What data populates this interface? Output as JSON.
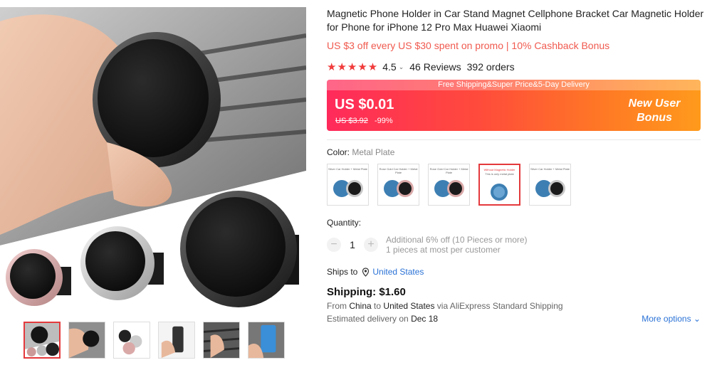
{
  "product": {
    "title": "Magnetic Phone Holder in Car Stand Magnet Cellphone Bracket Car Magnetic Holder for Phone for iPhone 12 Pro Max Huawei Xiaomi",
    "promo": "US $3 off every US $30 spent on promo | 10% Cashback Bonus",
    "rating": {
      "stars": "★★★★★",
      "value": "4.5",
      "reviews": "46 Reviews",
      "orders": "392 orders"
    }
  },
  "price": {
    "banner": "Free Shipping&Super Price&5-Day Delivery",
    "current": "US $0.01",
    "original": "US $3.92",
    "discount": "-99%",
    "new_user_line1": "New User",
    "new_user_line2": "Bonus"
  },
  "color": {
    "label": "Color:",
    "selected": "Metal Plate",
    "options": [
      {
        "caption": "Silver Car Holder + Metal Plate",
        "holder": "#c8c8c8",
        "name": "silver"
      },
      {
        "caption": "Rose Gold Car Holder + Metal Plate",
        "holder": "#d9a9a8",
        "name": "rose-gold"
      },
      {
        "caption": "Rose Gold Car Holder + Metal Plate",
        "holder": "#d9a9a8",
        "name": "rose-gold-2"
      },
      {
        "caption": "Without Magnetic Holder",
        "caption2": "This is only metal plate",
        "name": "metal-plate"
      },
      {
        "caption": "Silver Car Holder + Metal Plate",
        "holder": "#c8c8c8",
        "name": "silver-2"
      }
    ]
  },
  "quantity": {
    "label": "Quantity:",
    "value": "1",
    "minus": "−",
    "plus": "+",
    "note1": "Additional 6% off (10 Pieces or more)",
    "note2": "1 pieces at most per customer"
  },
  "shipping": {
    "ships_to_label": "Ships to",
    "ships_to": "United States",
    "title": "Shipping: $1.60",
    "from_prefix": "From",
    "from": "China",
    "to_prefix": "to",
    "to": "United States",
    "via": "via AliExpress Standard Shipping",
    "estimated_prefix": "Estimated delivery on",
    "estimated_date": "Dec 18",
    "more_options": "More options"
  },
  "colors": {
    "accent_red": "#e4393c",
    "promo_red": "#f05a4f",
    "link_blue": "#2a72d6"
  }
}
